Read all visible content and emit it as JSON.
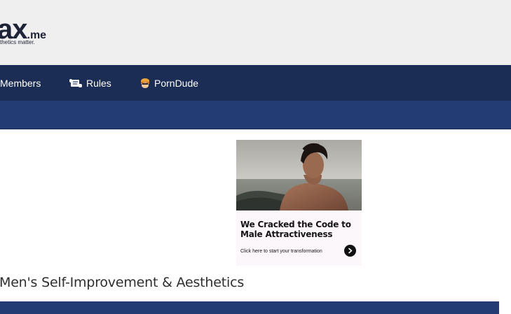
{
  "header": {
    "logo_main": "ax",
    "logo_tld": ".me",
    "tagline": "sthetics matter."
  },
  "nav": {
    "items": [
      {
        "label": "Members",
        "icon": "none"
      },
      {
        "label": "Rules",
        "icon": "scroll-icon"
      },
      {
        "label": "PornDude",
        "icon": "porndude-icon"
      }
    ]
  },
  "ad": {
    "headline": "We Cracked the Code to Male Attractiveness",
    "cta": "Click here to start your transformation",
    "arrow_icon": "chevron-right-icon"
  },
  "page": {
    "heading": "Men's Self-Improvement & Aesthetics"
  },
  "colors": {
    "header_bg": "#efefef",
    "nav_bg": "#1b2d55",
    "subnav_bg": "#243c74",
    "section_bar": "#243c74",
    "text_dark": "#2e2e2e"
  }
}
